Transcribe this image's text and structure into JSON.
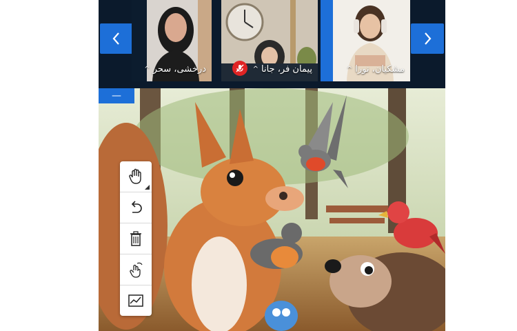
{
  "participants": [
    {
      "name": "مشکیان، نورا",
      "caret": "^"
    },
    {
      "name": "پیمان فر، جانا",
      "caret": "^",
      "muted": true
    },
    {
      "name": "درخشی، سحر",
      "caret": "^"
    }
  ],
  "navigation": {
    "prev_icon": "chevron-left-icon",
    "next_icon": "chevron-right-icon"
  },
  "stage": {
    "collapse_label": "—"
  },
  "toolbar": {
    "tools": [
      "hand-icon",
      "undo-icon",
      "trash-icon",
      "pointer-gesture-icon",
      "chart-icon"
    ]
  },
  "colors": {
    "accent": "#1d6fd8",
    "strip_bg": "#0b1a2c",
    "mute": "#e02424"
  }
}
